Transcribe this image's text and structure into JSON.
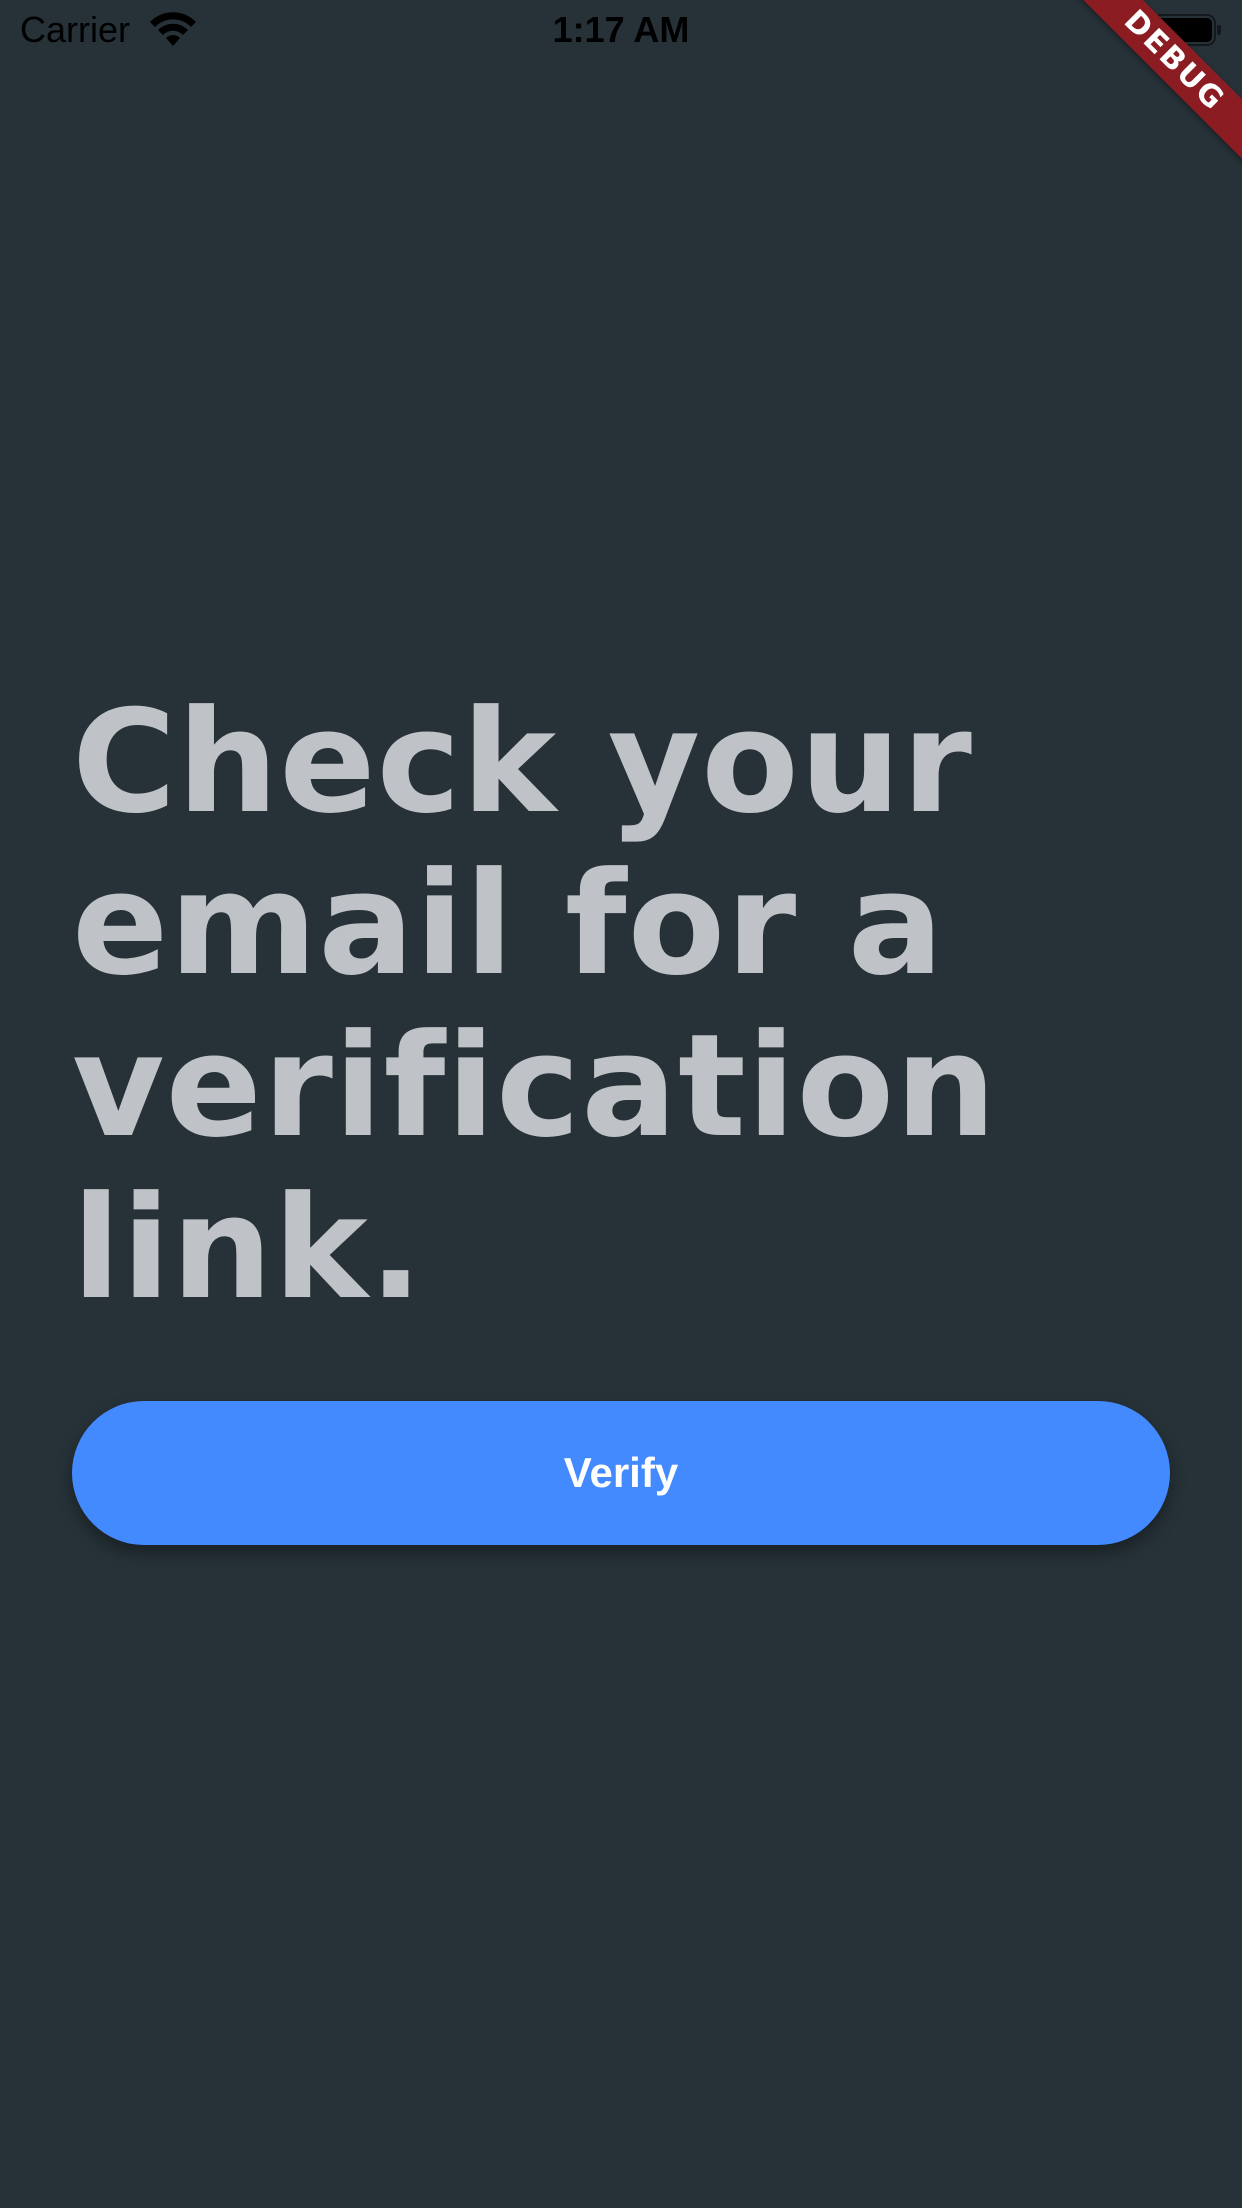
{
  "status_bar": {
    "carrier": "Carrier",
    "time": "1:17 AM",
    "wifi_icon": "wifi-icon",
    "battery_icon": "battery-icon"
  },
  "debug_banner": {
    "label": "DEBUG",
    "color": "#8b1c22"
  },
  "main": {
    "headline": "Check your email for a verification link.",
    "verify_button_label": "Verify"
  },
  "colors": {
    "background": "#263238",
    "headline_text": "#bfc2c6",
    "accent": "#448aff",
    "button_text": "#ffffff"
  }
}
